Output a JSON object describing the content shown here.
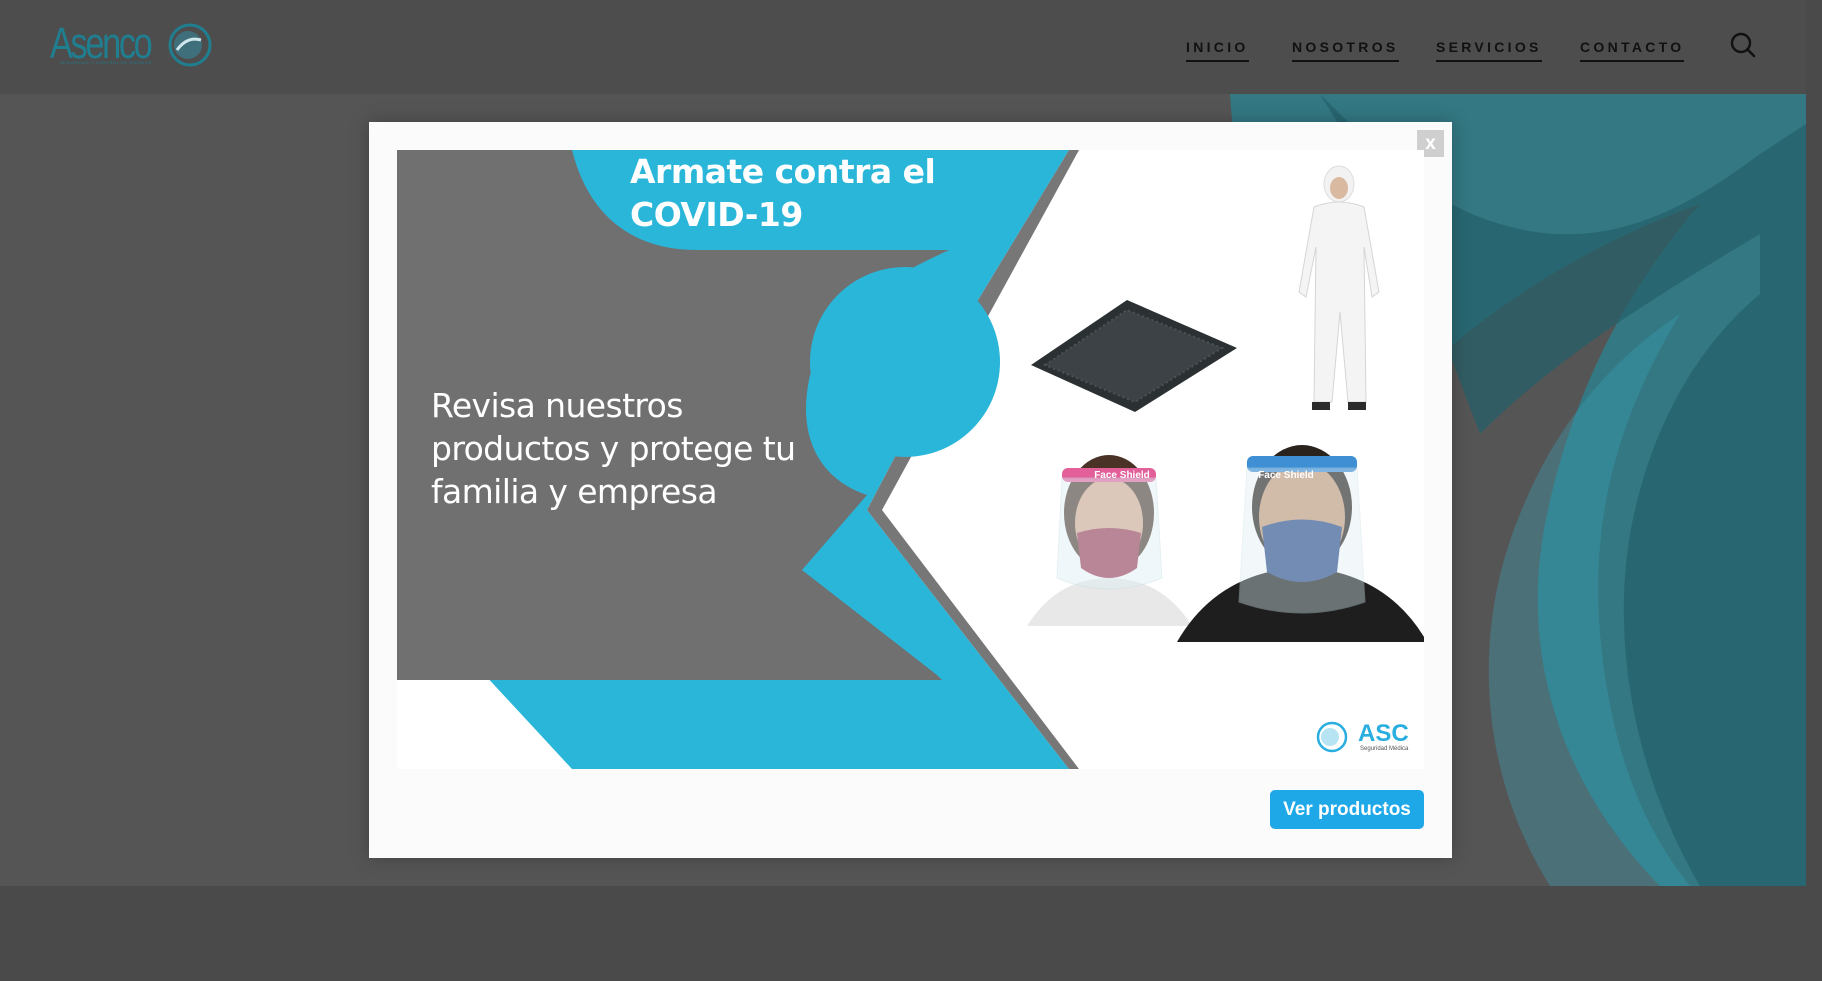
{
  "header": {
    "logo": {
      "text": "Asenco",
      "tagline": "SEGURIDAD Y CONTROL DE RIESGOS",
      "brand_color": "#1f7e8f"
    },
    "nav": [
      {
        "label": "INICIO"
      },
      {
        "label": "NOSOTROS"
      },
      {
        "label": "SERVICIOS"
      },
      {
        "label": "CONTACTO"
      }
    ],
    "search_icon": "search-icon"
  },
  "modal": {
    "close_label": "x",
    "banner": {
      "title": "Armate contra el COVID-19",
      "body": "Revisa nuestros productos y protege tu familia y empresa",
      "accent_color": "#2ab6d9",
      "panel_color": "#707070",
      "products": [
        {
          "name": "protective-suit"
        },
        {
          "name": "sanitizing-mat"
        },
        {
          "name": "face-shield-girl",
          "label": "Face Shield"
        },
        {
          "name": "face-shield-man",
          "label": "Face Shield"
        }
      ],
      "brand": {
        "name": "ASC",
        "subtitle": "Seguridad Médica"
      }
    },
    "cta_label": "Ver productos",
    "cta_color": "#1ea8e8"
  }
}
